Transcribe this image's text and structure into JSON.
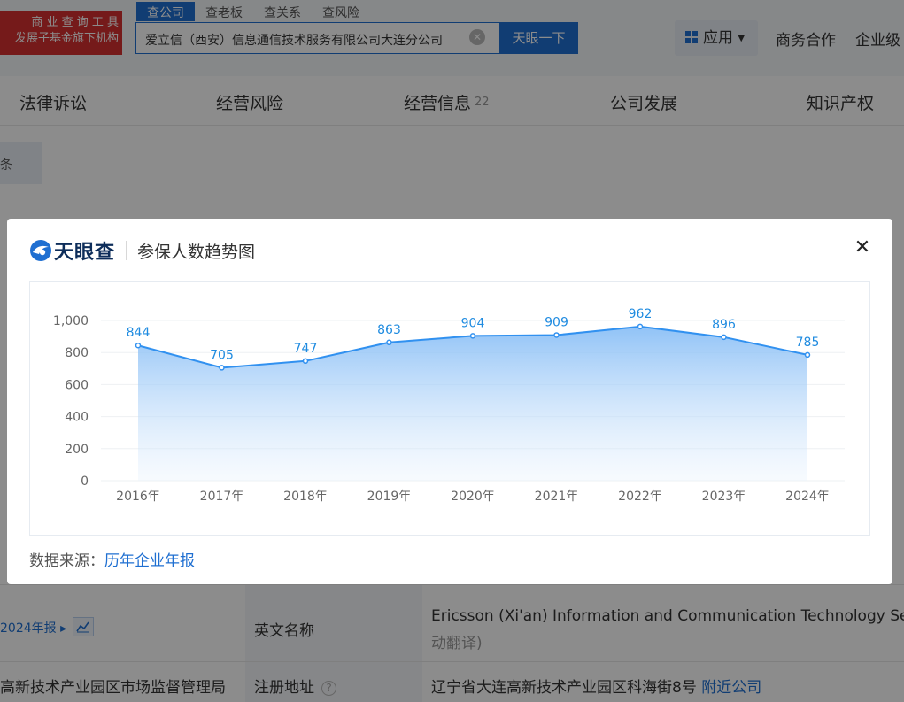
{
  "header": {
    "badge_line1": "商 业 查 询 工 具",
    "badge_line2": "发展子基金旗下机构",
    "search_tabs": [
      "查公司",
      "查老板",
      "查关系",
      "查风险"
    ],
    "search_value": "爱立信（西安）信息通信技术服务有限公司大连分公司",
    "search_button": "天眼一下",
    "apps_label": "应用",
    "links": [
      "商务合作",
      "企业级"
    ]
  },
  "nav": {
    "items": [
      {
        "label": "法律诉讼",
        "count": ""
      },
      {
        "label": "经营风险",
        "count": ""
      },
      {
        "label": "经营信息",
        "count": "22"
      },
      {
        "label": "公司发展",
        "count": ""
      },
      {
        "label": "知识产权",
        "count": ""
      }
    ]
  },
  "background": {
    "side_text": "条",
    "report_link": "2024年报",
    "english_name_label": "英文名称",
    "english_name_value": "Ericsson (Xi'an) Information and Communication Technology Service",
    "english_name_note": "动翻译)",
    "authority": "高新技术产业园区市场监督管理局",
    "address_label": "注册地址",
    "address_value": "辽宁省大连高新技术产业园区科海街8号",
    "nearby_link": "附近公司",
    "help_glyph": "?"
  },
  "modal": {
    "brand_name": "天眼查",
    "title": "参保人数趋势图",
    "close_glyph": "✕",
    "source_label": "数据来源：",
    "source_link": "历年企业年报"
  },
  "chart_data": {
    "type": "area",
    "title": "参保人数趋势图",
    "categories": [
      "2016年",
      "2017年",
      "2018年",
      "2019年",
      "2020年",
      "2021年",
      "2022年",
      "2023年",
      "2024年"
    ],
    "values": [
      844,
      705,
      747,
      863,
      904,
      909,
      962,
      896,
      785
    ],
    "ylim": [
      0,
      1000
    ],
    "yticks": [
      "0",
      "200",
      "400",
      "600",
      "800",
      "1,000"
    ],
    "grid": true,
    "line_color": "#3191f0",
    "label_color": "#1f8be0"
  },
  "colors": {
    "accent": "#1f6fd1",
    "badge": "#d63030"
  }
}
